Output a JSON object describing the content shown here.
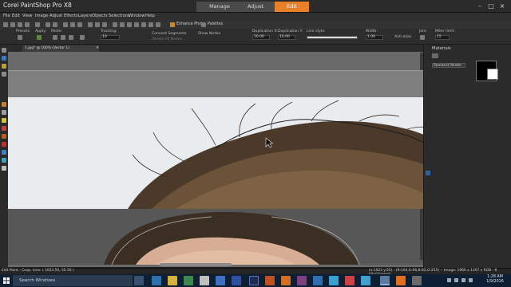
{
  "window": {
    "title": "Corel PaintShop Pro X8",
    "modes": [
      "Manage",
      "Adjust",
      "Edit"
    ],
    "active_mode": "Edit",
    "controls": [
      "–",
      "□",
      "×"
    ]
  },
  "menu": [
    "File",
    "Edit",
    "View",
    "Image",
    "Adjust",
    "Effects",
    "Layers",
    "Objects",
    "Selections",
    "Window",
    "Help"
  ],
  "toolbar": {
    "enhance_photo": "Enhance Photo",
    "palettes": "Palettes"
  },
  "options": {
    "presets": "Presets:",
    "apply": "Apply:",
    "mode": "Mode:",
    "tracking": "Tracking:",
    "tracking_value": "10",
    "connect_segments": "Connect Segments",
    "delete_all_nodes": "Delete All Nodes",
    "show_nodes": "Show Nodes",
    "duplication_x": "Duplication X:",
    "duplication_x_value": "10.00",
    "duplication_y": "Duplication Y:",
    "duplication_y_value": "10.00",
    "line_style": "Line style:",
    "width": "Width:",
    "width_value": "1.00",
    "antialias": "Anti-alias",
    "join": "Join:",
    "miter_limit": "Miter limit:",
    "miter_limit_value": "15"
  },
  "document": {
    "tab_label": "1.jpg* @ 100% (Vector 1)"
  },
  "materials": {
    "title": "Materials",
    "palette_dropdown": "Standard Palette"
  },
  "status": {
    "left": "Edit Point - Cusp, Line: ( 1023.50, 55.50 )",
    "right": "(x:1023 y:55) - (R:104,G:96,B:82,O:255) -- Image: 1960 x 1307 x RGB - 8 bits/channel"
  },
  "taskbar": {
    "search_placeholder": "Search Windows",
    "time": "1:28 AM",
    "date": "1/9/2016"
  },
  "colors": {
    "active_mode": "#e8802a",
    "taskbar": "#0f1f33"
  }
}
